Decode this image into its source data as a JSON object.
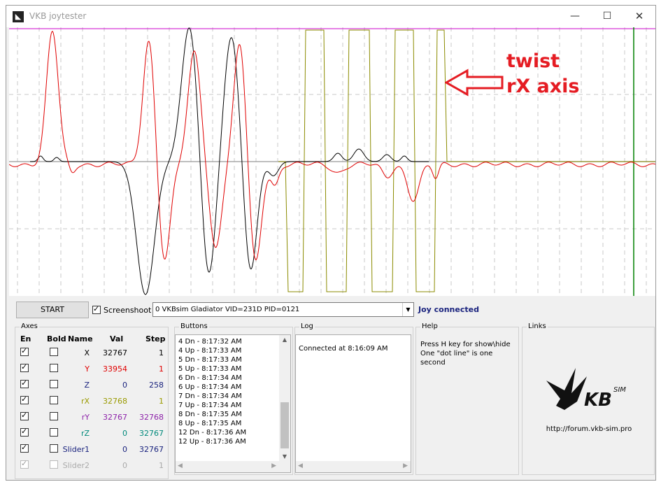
{
  "window": {
    "title": "VKB joytester",
    "minimize_glyph": "—",
    "maximize_glyph": "☐",
    "close_glyph": "✕",
    "app_icon": "vkb-bird-icon"
  },
  "toolbar": {
    "start_label": "START",
    "screenshoot_label": "Screenshoot",
    "screenshoot_checked": true,
    "device": "0 VKBsim Gladiator  VID=231D PID=0121",
    "status": "Joy connected"
  },
  "axes": {
    "title": "Axes",
    "headers": {
      "en": "En",
      "bold": "Bold",
      "name": "Name",
      "val": "Val",
      "step": "Step"
    },
    "rows": [
      {
        "name": "X",
        "val": "32767",
        "step": "1",
        "color": "#000000",
        "en": true,
        "bold": false,
        "disabled": false
      },
      {
        "name": "Y",
        "val": "33954",
        "step": "1",
        "color": "#e00000",
        "en": true,
        "bold": false,
        "disabled": false
      },
      {
        "name": "Z",
        "val": "0",
        "step": "258",
        "color": "#1a237e",
        "en": true,
        "bold": false,
        "disabled": false
      },
      {
        "name": "rX",
        "val": "32768",
        "step": "1",
        "color": "#9a9a00",
        "en": true,
        "bold": false,
        "disabled": false
      },
      {
        "name": "rY",
        "val": "32767",
        "step": "32768",
        "color": "#8e24aa",
        "en": true,
        "bold": false,
        "disabled": false
      },
      {
        "name": "rZ",
        "val": "0",
        "step": "32767",
        "color": "#00897b",
        "en": true,
        "bold": false,
        "disabled": false
      },
      {
        "name": "Slider1",
        "val": "0",
        "step": "32767",
        "color": "#1a237e",
        "en": true,
        "bold": false,
        "disabled": false
      },
      {
        "name": "Slider2",
        "val": "0",
        "step": "1",
        "color": "#aaaaaa",
        "en": true,
        "bold": false,
        "disabled": true
      }
    ]
  },
  "buttons": {
    "title": "Buttons",
    "items": [
      "4 Dn - 8:17:32 AM",
      "4 Up - 8:17:33 AM",
      "5 Dn - 8:17:33 AM",
      "5 Up - 8:17:33 AM",
      "6 Dn - 8:17:34 AM",
      "6 Up - 8:17:34 AM",
      "7 Dn - 8:17:34 AM",
      "7 Up - 8:17:34 AM",
      "8 Dn - 8:17:35 AM",
      "8 Up - 8:17:35 AM",
      "12 Dn - 8:17:36 AM",
      "12 Up - 8:17:36 AM"
    ]
  },
  "log": {
    "title": "Log",
    "text": "Connected at 8:16:09 AM"
  },
  "help": {
    "title": "Help",
    "line1": "Press H key for show\\hide",
    "line2": "One \"dot line\" is one second"
  },
  "links": {
    "title": "Links",
    "url": "http://forum.vkb-sim.pro",
    "logo_text": "KB",
    "logo_sup": "SIM"
  },
  "annotation": {
    "line1": "twist",
    "line2": "rX axis",
    "color": "#e51c23"
  },
  "plot": {
    "colors": {
      "x": "#000000",
      "y": "#e00000",
      "rx": "#8b8b00",
      "ref": "#aaaaaa",
      "top": "#cc00cc",
      "cursor": "#008000",
      "grid": "#c8c8c8"
    }
  }
}
